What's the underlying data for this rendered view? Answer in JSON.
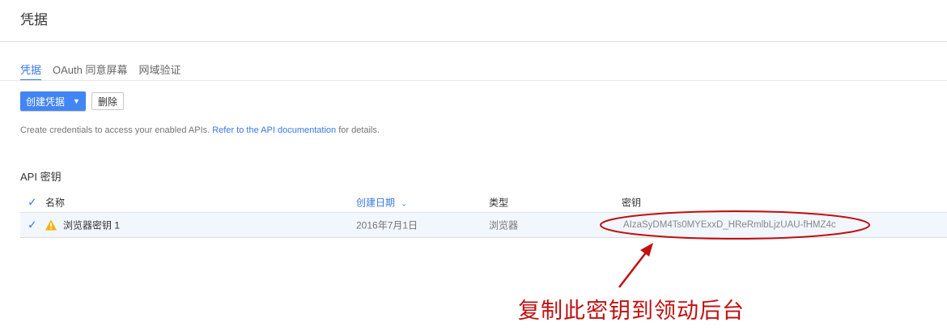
{
  "header": {
    "title": "凭据"
  },
  "tabs": [
    {
      "label": "凭据",
      "active": true
    },
    {
      "label": "OAuth 同意屏幕",
      "active": false
    },
    {
      "label": "网域验证",
      "active": false
    }
  ],
  "toolbar": {
    "create_label": "创建凭据",
    "delete_label": "删除"
  },
  "description": {
    "prefix": "Create credentials to access your enabled APIs.",
    "link": "Refer to the API documentation",
    "suffix": "for details."
  },
  "section": {
    "title": "API 密钥"
  },
  "table": {
    "columns": {
      "name": "名称",
      "created": "创建日期",
      "type": "类型",
      "key": "密钥"
    },
    "rows": [
      {
        "name": "浏览器密钥 1",
        "created": "2016年7月1日",
        "type": "浏览器",
        "key": "AIzaSyDM4Ts0MYExxD_HReRmlbLjzUAU-fHMZ4c"
      }
    ]
  },
  "annotation": {
    "text": "复制此密钥到领动后台"
  },
  "colors": {
    "accent": "#4285f4",
    "link": "#3b78e7",
    "annotation": "#c01010",
    "warning": "#f4b400"
  }
}
